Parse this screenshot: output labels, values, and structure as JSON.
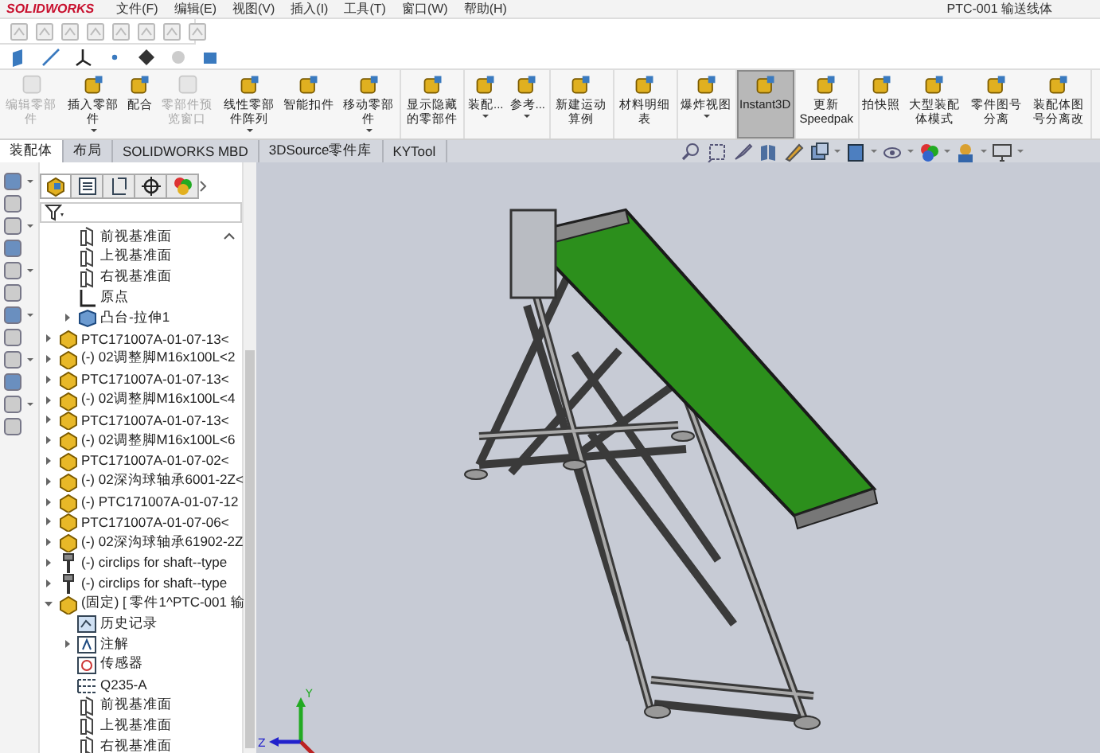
{
  "window": {
    "logo": "SOLIDWORKS",
    "menu": [
      "文件(F)",
      "编辑(E)",
      "视图(V)",
      "插入(I)",
      "工具(T)",
      "窗口(W)",
      "帮助(H)"
    ],
    "title": "PTC-001 输送线体"
  },
  "command_manager": {
    "groups": [
      {
        "buttons": [
          {
            "label": "编辑零部件",
            "disabled": true,
            "dropdown": false,
            "selected": false
          },
          {
            "label": "插入零部件",
            "disabled": false,
            "dropdown": true,
            "selected": false
          },
          {
            "label": "配合",
            "disabled": false,
            "dropdown": false,
            "selected": false
          },
          {
            "label": "零部件预览窗口",
            "disabled": true,
            "dropdown": false,
            "selected": false
          },
          {
            "label": "线性零部件阵列",
            "disabled": false,
            "dropdown": true,
            "selected": false
          },
          {
            "label": "智能扣件",
            "disabled": false,
            "dropdown": false,
            "selected": false
          },
          {
            "label": "移动零部件",
            "disabled": false,
            "dropdown": true,
            "selected": false
          }
        ]
      },
      {
        "buttons": [
          {
            "label": "显示隐藏的零部件",
            "disabled": false,
            "dropdown": false,
            "selected": false
          }
        ]
      },
      {
        "buttons": [
          {
            "label": "装配...",
            "disabled": false,
            "dropdown": true,
            "selected": false
          },
          {
            "label": "参考...",
            "disabled": false,
            "dropdown": true,
            "selected": false
          }
        ]
      },
      {
        "buttons": [
          {
            "label": "新建运动算例",
            "disabled": false,
            "dropdown": false,
            "selected": false
          }
        ]
      },
      {
        "buttons": [
          {
            "label": "材料明细表",
            "disabled": false,
            "dropdown": false,
            "selected": false
          }
        ]
      },
      {
        "buttons": [
          {
            "label": "爆炸视图",
            "disabled": false,
            "dropdown": true,
            "selected": false
          }
        ]
      },
      {
        "buttons": [
          {
            "label": "Instant3D",
            "disabled": false,
            "dropdown": false,
            "selected": true
          }
        ]
      },
      {
        "buttons": [
          {
            "label": "更新Speedpak",
            "disabled": false,
            "dropdown": false,
            "selected": false
          }
        ]
      },
      {
        "buttons": [
          {
            "label": "拍快照",
            "disabled": false,
            "dropdown": false,
            "selected": false
          },
          {
            "label": "大型装配体模式",
            "disabled": false,
            "dropdown": false,
            "selected": false
          },
          {
            "label": "零件图号分离",
            "disabled": false,
            "dropdown": false,
            "selected": false
          },
          {
            "label": "装配体图号分离改",
            "disabled": false,
            "dropdown": false,
            "selected": false
          }
        ]
      }
    ]
  },
  "tabs": [
    {
      "label": "装配体",
      "selected": true
    },
    {
      "label": "布局",
      "selected": false
    },
    {
      "label": "SOLIDWORKS MBD",
      "selected": false
    },
    {
      "label": "3DSource零件库",
      "selected": false
    },
    {
      "label": "KYTool",
      "selected": false
    }
  ],
  "panel_tabs": [
    {
      "selected": true
    },
    {
      "selected": false
    },
    {
      "selected": false
    },
    {
      "selected": false
    },
    {
      "selected": false
    }
  ],
  "feature_tree": {
    "partial_children": [
      {
        "label": "前视基准面",
        "kind": "plane"
      },
      {
        "label": "上视基准面",
        "kind": "plane"
      },
      {
        "label": "右视基准面",
        "kind": "plane"
      },
      {
        "label": "原点",
        "kind": "origin"
      },
      {
        "label": "凸台-拉伸1",
        "kind": "feature",
        "expanded": false
      }
    ],
    "items": [
      {
        "label": "PTC171007A-01-07-13<",
        "kind": "part",
        "expanded": false
      },
      {
        "label": "(-) 02调整脚M16x100L<2",
        "kind": "part",
        "expanded": false
      },
      {
        "label": "PTC171007A-01-07-13<",
        "kind": "part",
        "expanded": false
      },
      {
        "label": "(-) 02调整脚M16x100L<4",
        "kind": "part",
        "expanded": false
      },
      {
        "label": "PTC171007A-01-07-13<",
        "kind": "part",
        "expanded": false
      },
      {
        "label": "(-) 02调整脚M16x100L<6",
        "kind": "part",
        "expanded": false
      },
      {
        "label": "PTC171007A-01-07-02<",
        "kind": "part",
        "expanded": false
      },
      {
        "label": "(-) 02深沟球轴承6001-2Z<",
        "kind": "part",
        "expanded": false
      },
      {
        "label": "(-) PTC171007A-01-07-12",
        "kind": "part",
        "expanded": false
      },
      {
        "label": "PTC171007A-01-07-06<",
        "kind": "part",
        "expanded": false
      },
      {
        "label": "(-) 02深沟球轴承61902-2Z",
        "kind": "part",
        "expanded": false
      },
      {
        "label": "(-) circlips for shaft--type",
        "kind": "fastener",
        "expanded": false
      },
      {
        "label": "(-) circlips for shaft--type",
        "kind": "fastener",
        "expanded": false
      },
      {
        "label": "(固定) [ 零件1^PTC-001 输",
        "kind": "part",
        "expanded": true,
        "children": [
          {
            "label": "历史记录",
            "kind": "history"
          },
          {
            "label": "注解",
            "kind": "annotation",
            "expanded": false
          },
          {
            "label": "传感器",
            "kind": "sensor"
          },
          {
            "label": "Q235-A",
            "kind": "material"
          },
          {
            "label": "前视基准面",
            "kind": "plane"
          },
          {
            "label": "上视基准面",
            "kind": "plane"
          },
          {
            "label": "右视基准面",
            "kind": "plane"
          }
        ]
      }
    ]
  },
  "triad": {
    "y": "Y",
    "z": "Z"
  }
}
